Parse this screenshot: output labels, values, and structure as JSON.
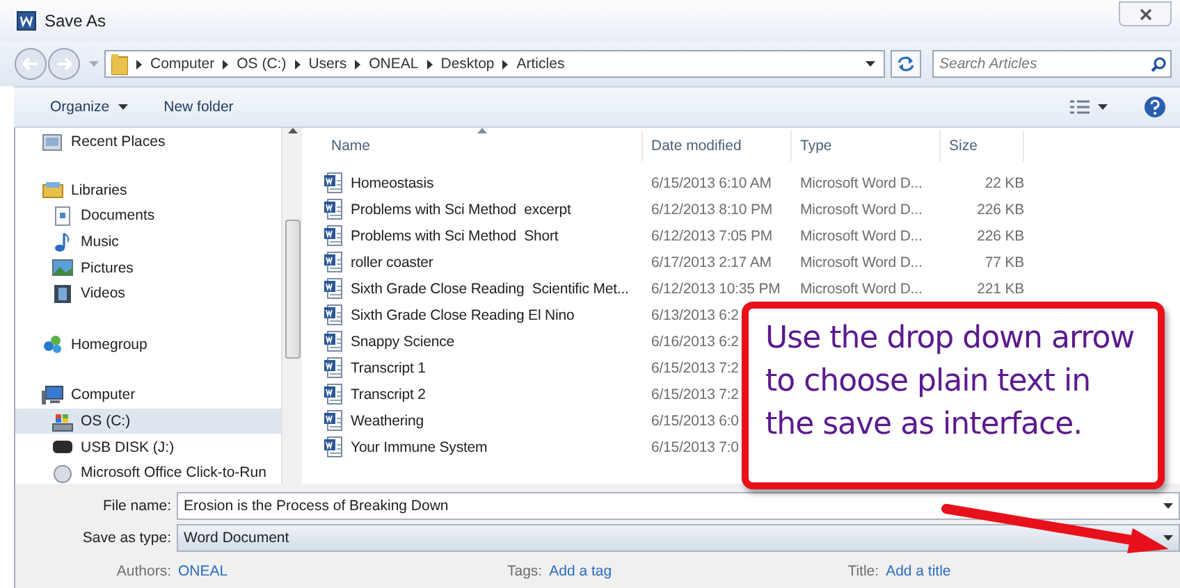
{
  "window": {
    "title": "Save As"
  },
  "address": {
    "segments": [
      "Computer",
      "OS (C:)",
      "Users",
      "ONEAL",
      "Desktop",
      "Articles"
    ],
    "search_placeholder": "Search Articles"
  },
  "toolbar": {
    "organize": "Organize",
    "new_folder": "New folder"
  },
  "nav": [
    {
      "label": "Recent Places",
      "kind": "recent",
      "selected": false
    },
    {
      "label": "Libraries",
      "kind": "library",
      "selected": false,
      "children": [
        {
          "label": "Documents",
          "kind": "documents",
          "selected": false
        },
        {
          "label": "Music",
          "kind": "music",
          "selected": false
        },
        {
          "label": "Pictures",
          "kind": "pictures",
          "selected": false
        },
        {
          "label": "Videos",
          "kind": "videos",
          "selected": false
        }
      ]
    },
    {
      "label": "Homegroup",
      "kind": "homegroup",
      "selected": false
    },
    {
      "label": "Computer",
      "kind": "computer",
      "selected": false,
      "children": [
        {
          "label": "OS (C:)",
          "kind": "drive",
          "selected": true
        },
        {
          "label": "USB DISK (J:)",
          "kind": "usb",
          "selected": false
        },
        {
          "label": "Microsoft Office Click-to-Run",
          "kind": "app",
          "selected": false
        }
      ]
    }
  ],
  "table": {
    "columns": [
      "Name",
      "Date modified",
      "Type",
      "Size"
    ],
    "rows": [
      {
        "name": "Homeostasis",
        "date": "6/15/2013 6:10 AM",
        "type": "Microsoft Word D...",
        "size": "22 KB"
      },
      {
        "name": "Problems with Sci Method  excerpt",
        "date": "6/12/2013 8:10 PM",
        "type": "Microsoft Word D...",
        "size": "226 KB"
      },
      {
        "name": "Problems with Sci Method  Short",
        "date": "6/12/2013 7:05 PM",
        "type": "Microsoft Word D...",
        "size": "226 KB"
      },
      {
        "name": "roller coaster",
        "date": "6/17/2013 2:17 AM",
        "type": "Microsoft Word D...",
        "size": "77 KB"
      },
      {
        "name": "Sixth Grade Close Reading  Scientific Met...",
        "date": "6/12/2013 10:35 PM",
        "type": "Microsoft Word D...",
        "size": "221 KB"
      },
      {
        "name": "Sixth Grade Close Reading El Nino",
        "date": "6/13/2013 6:2"
      },
      {
        "name": "Snappy Science",
        "date": "6/16/2013 6:2"
      },
      {
        "name": "Transcript 1",
        "date": "6/15/2013 7:2"
      },
      {
        "name": "Transcript 2",
        "date": "6/15/2013 7:2"
      },
      {
        "name": "Weathering",
        "date": "6/15/2013 6:0"
      },
      {
        "name": "Your Immune System",
        "date": "6/15/2013 7:0"
      }
    ]
  },
  "form": {
    "file_name_label": "File name:",
    "file_name": "Erosion is the Process of Breaking Down",
    "type_label": "Save as type:",
    "type": "Word Document",
    "meta": [
      {
        "label": "Authors:",
        "value": "ONEAL"
      },
      {
        "label": "Tags:",
        "value": "Add a tag"
      },
      {
        "label": "Title:",
        "value": "Add a title"
      }
    ]
  },
  "callout": {
    "text": "Use the drop down arrow to choose plain text in the save as interface."
  }
}
